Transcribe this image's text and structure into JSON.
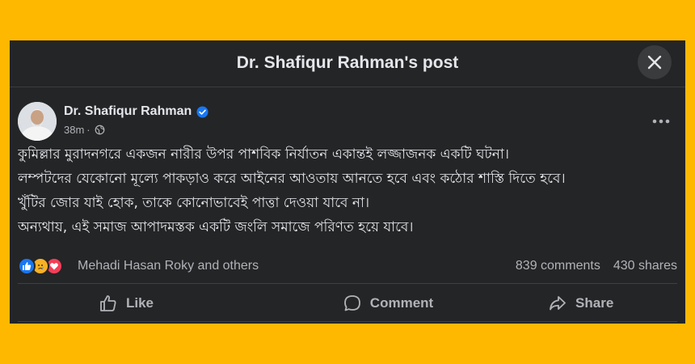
{
  "modal": {
    "title": "Dr. Shafiqur Rahman's post"
  },
  "post": {
    "author": "Dr. Shafiqur Rahman",
    "time": "38m",
    "meta_dot": "·",
    "text_lines": [
      "কুমিল্লার মুরাদনগরে একজন নারীর উপর পাশবিক নির্যাতন একান্তই লজ্জাজনক একটি ঘটনা।",
      "লম্পটদের যেকোনো মূল্যে পাকড়াও করে আইনের আওতায় আনতে হবে এবং কঠোর শাস্তি দিতে হবে।",
      "খুঁটির জোর যাই হোক, তাকে কোনোভাবেই পাত্তা দেওয়া যাবে না।",
      "অন্যথায়, এই সমাজ আপাদমস্তক একটি জংলি সমাজে পরিণত হয়ে যাবে।"
    ]
  },
  "reactions": {
    "icons": [
      "like-reaction",
      "sad-reaction",
      "love-reaction"
    ],
    "names": "Mehadi Hasan Roky and others",
    "comments": "839 comments",
    "shares": "430 shares"
  },
  "actions": {
    "like": "Like",
    "comment": "Comment",
    "share": "Share"
  },
  "colors": {
    "page_background": "#FFB800",
    "modal_background": "#242526",
    "primary_text": "#E4E6EB",
    "secondary_text": "#B0B3B8",
    "verified_blue": "#1877F2",
    "like_blue": "#1877F2",
    "sad_yellow": "#F7B125",
    "love_red": "#F33E58"
  }
}
